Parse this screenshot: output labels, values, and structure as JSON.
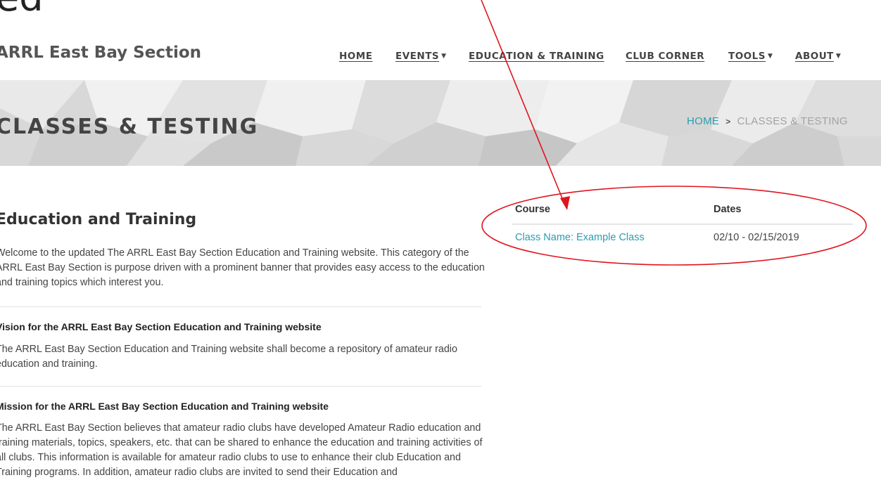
{
  "corner_text": "ed",
  "header": {
    "brand": "ARRL East Bay Section",
    "nav": [
      {
        "label": "HOME",
        "dropdown": false
      },
      {
        "label": "EVENTS",
        "dropdown": true
      },
      {
        "label": "EDUCATION & TRAINING",
        "dropdown": false
      },
      {
        "label": "CLUB CORNER",
        "dropdown": false
      },
      {
        "label": "TOOLS",
        "dropdown": true
      },
      {
        "label": "ABOUT",
        "dropdown": true
      }
    ],
    "caret_icon": "caret-down-icon"
  },
  "banner": {
    "title": "CLASSES & TESTING",
    "breadcrumb": {
      "home": "HOME",
      "separator": ">",
      "current": "CLASSES & TESTING"
    }
  },
  "main": {
    "heading": "Education and Training",
    "intro": "Welcome to the updated The ARRL East Bay Section Education and Training website. This category of the ARRL East Bay Section is purpose driven with a prominent banner that provides easy access to the education and training topics which interest you.",
    "vision_heading": "Vision for the ARRL East Bay Section Education and Training website",
    "vision_text": "The ARRL East Bay Section Education and Training website shall become a repository of amateur radio education and training.",
    "mission_heading": "Mission for the ARRL East Bay Section Education and Training website",
    "mission_text": "The ARRL East Bay Section believes that amateur radio clubs have developed Amateur Radio education and training materials, topics, speakers, etc. that can be shared to enhance the education and training activities of all clubs. This information is available for amateur radio clubs to use to enhance their club Education and Training programs. In addition, amateur radio clubs are invited to send their Education and"
  },
  "course_table": {
    "headers": {
      "course": "Course",
      "dates": "Dates"
    },
    "rows": [
      {
        "course": "Class Name: Example Class",
        "dates": "02/10 - 02/15/2019"
      }
    ]
  },
  "colors": {
    "accent": "#2a9db0",
    "annotation": "#e0141e"
  }
}
